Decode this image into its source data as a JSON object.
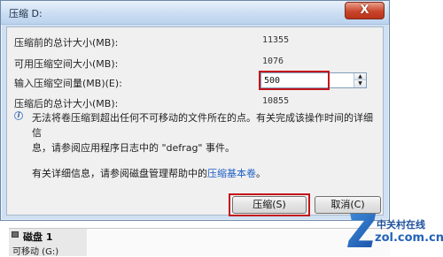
{
  "window": {
    "title": "压缩 D:",
    "close_glyph": "X"
  },
  "fields": [
    {
      "label": "压缩前的总计大小(MB):",
      "value": "11355"
    },
    {
      "label": "可用压缩空间大小(MB):",
      "value": "1076"
    },
    {
      "label": "输入压缩空间量(MB)(E):",
      "value": "500"
    },
    {
      "label": "压缩后的总计大小(MB):",
      "value": "10855"
    }
  ],
  "info": {
    "line1": "无法将卷压缩到超出任何不可移动的文件所在的点。有关完成该操作时间的详细信",
    "line2": "息，请参阅应用程序日志中的 \"defrag\" 事件。"
  },
  "help": {
    "prefix": "有关详细信息，请参阅磁盘管理帮助中的",
    "link": "压缩基本卷",
    "suffix": "。"
  },
  "buttons": {
    "compress": "压缩(S)",
    "cancel": "取消(C)"
  },
  "background": {
    "disk_name": "磁盘 1",
    "disk_sub": "可移动 (G:)"
  },
  "watermark": {
    "top": "中关村在线",
    "bottom": "zol.com.cn"
  },
  "colors": {
    "highlight": "#c4141b",
    "link": "#1d5fc2",
    "frame": "#cfe0f2"
  }
}
